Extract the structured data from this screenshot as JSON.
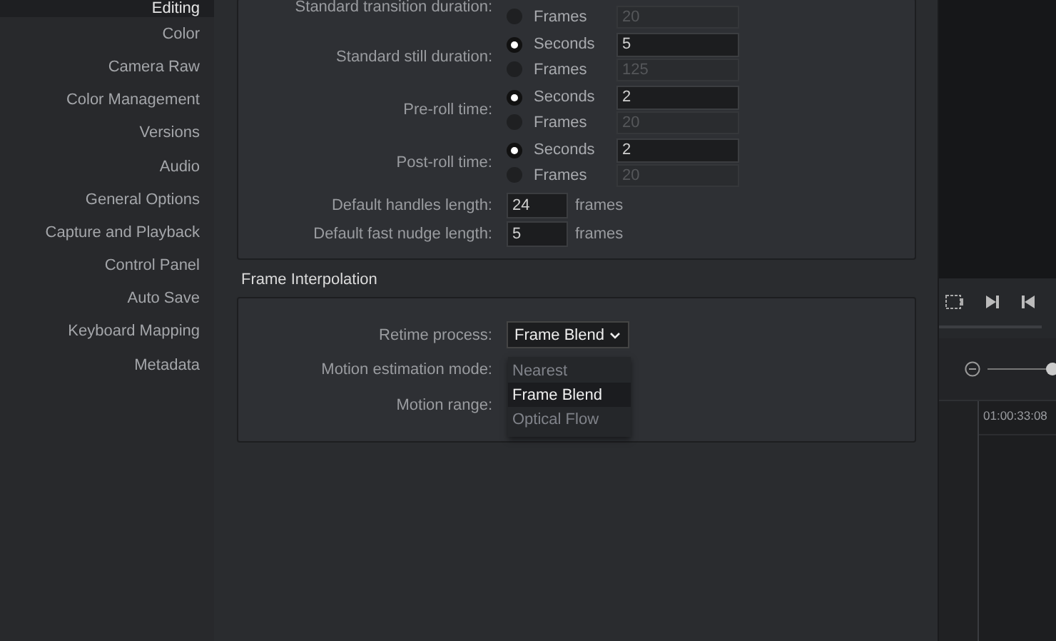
{
  "sidebar": {
    "items": [
      {
        "label": "Editing",
        "selected": true
      },
      {
        "label": "Color",
        "selected": false
      },
      {
        "label": "Camera Raw",
        "selected": false
      },
      {
        "label": "Color Management",
        "selected": false
      },
      {
        "label": "Versions",
        "selected": false
      },
      {
        "label": "Audio",
        "selected": false
      },
      {
        "label": "General Options",
        "selected": false
      },
      {
        "label": "Capture and Playback",
        "selected": false
      },
      {
        "label": "Control Panel",
        "selected": false
      },
      {
        "label": "Auto Save",
        "selected": false
      },
      {
        "label": "Keyboard Mapping",
        "selected": false
      },
      {
        "label": "Metadata",
        "selected": false
      }
    ]
  },
  "editing": {
    "timing_groups": [
      {
        "label": "Standard transition duration:",
        "options": [
          {
            "label": "Frames",
            "selected": false,
            "value": "20"
          }
        ]
      },
      {
        "label": "Standard still duration:",
        "options": [
          {
            "label": "Seconds",
            "selected": true,
            "value": "5"
          },
          {
            "label": "Frames",
            "selected": false,
            "value": "125"
          }
        ]
      },
      {
        "label": "Pre-roll time:",
        "options": [
          {
            "label": "Seconds",
            "selected": true,
            "value": "2"
          },
          {
            "label": "Frames",
            "selected": false,
            "value": "20"
          }
        ]
      },
      {
        "label": "Post-roll time:",
        "options": [
          {
            "label": "Seconds",
            "selected": true,
            "value": "2"
          },
          {
            "label": "Frames",
            "selected": false,
            "value": "20"
          }
        ]
      }
    ],
    "lengths": [
      {
        "label": "Default handles length:",
        "value": "24",
        "unit": "frames"
      },
      {
        "label": "Default fast nudge length:",
        "value": "5",
        "unit": "frames"
      }
    ]
  },
  "frame_interpolation": {
    "title": "Frame Interpolation",
    "retime_process": {
      "label": "Retime process:",
      "value": "Frame Blend",
      "open": true,
      "options": [
        {
          "label": "Nearest",
          "selected": false
        },
        {
          "label": "Frame Blend",
          "selected": true
        },
        {
          "label": "Optical Flow",
          "selected": false
        }
      ]
    },
    "motion_estimation_mode": {
      "label": "Motion estimation mode:"
    },
    "motion_range": {
      "label": "Motion range:"
    }
  },
  "viewer": {
    "zoom_slider": {
      "level": 0.97
    },
    "timecode": "01:00:33:08"
  }
}
